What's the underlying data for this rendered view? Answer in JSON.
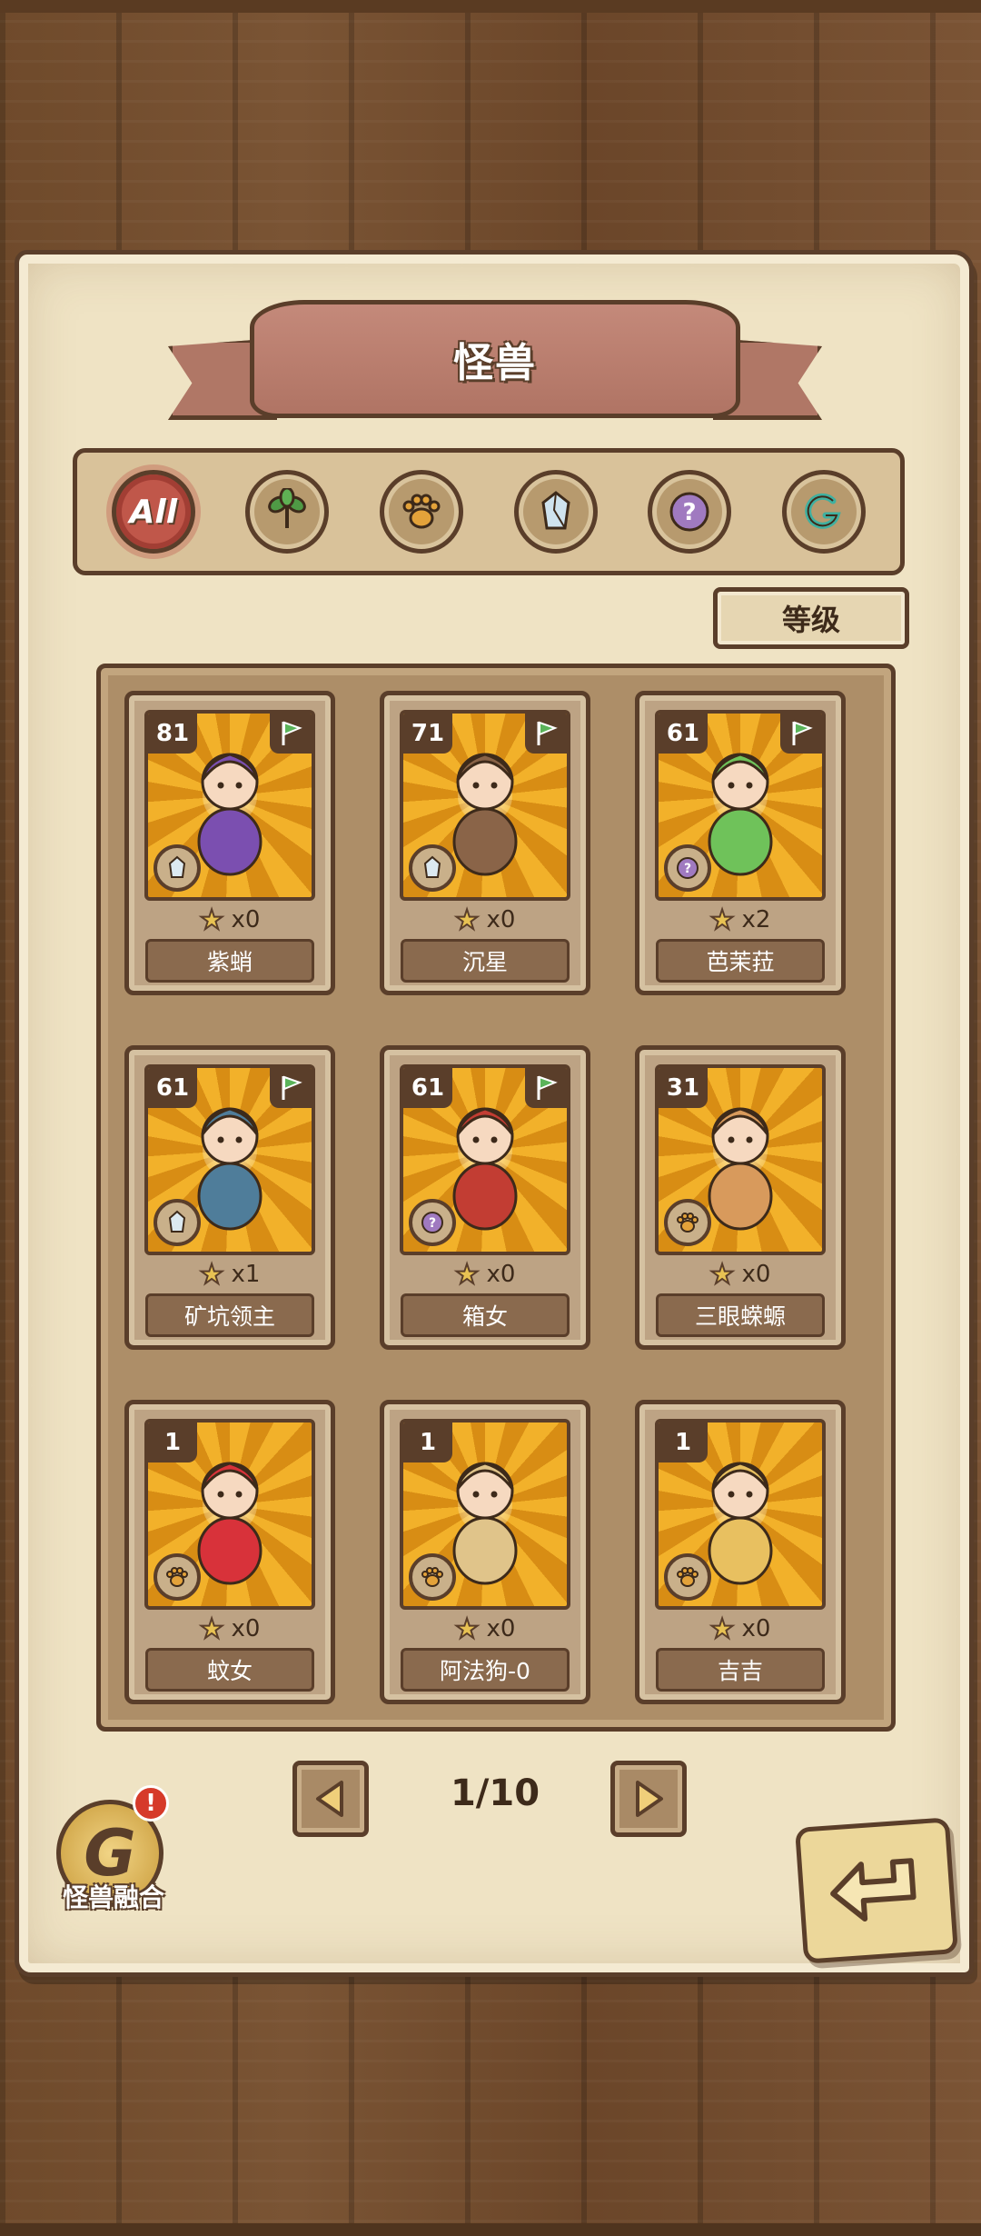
{
  "title": "怪兽",
  "filters": [
    {
      "label": "All",
      "icon": "all-icon",
      "active": true
    },
    {
      "label": "",
      "icon": "leaf-icon",
      "active": false
    },
    {
      "label": "",
      "icon": "paw-icon",
      "active": false
    },
    {
      "label": "",
      "icon": "crystal-icon",
      "active": false
    },
    {
      "label": "",
      "icon": "question-icon",
      "active": false
    },
    {
      "label": "",
      "icon": "fusion-icon",
      "active": false
    }
  ],
  "sort_label": "等级",
  "monsters": [
    {
      "level": "81",
      "stars": "x0",
      "name": "紫蛸",
      "type_icon": "crystal-icon",
      "flag": true
    },
    {
      "level": "71",
      "stars": "x0",
      "name": "沉星",
      "type_icon": "crystal-icon",
      "flag": true
    },
    {
      "level": "61",
      "stars": "x2",
      "name": "芭茉菈",
      "type_icon": "question-icon",
      "flag": true
    },
    {
      "level": "61",
      "stars": "x1",
      "name": "矿坑领主",
      "type_icon": "crystal-icon",
      "flag": true
    },
    {
      "level": "61",
      "stars": "x0",
      "name": "箱女",
      "type_icon": "question-icon",
      "flag": true
    },
    {
      "level": "31",
      "stars": "x0",
      "name": "三眼蝾螈",
      "type_icon": "paw-icon",
      "flag": false
    },
    {
      "level": "1",
      "stars": "x0",
      "name": "蚊女",
      "type_icon": "paw-icon",
      "flag": false
    },
    {
      "level": "1",
      "stars": "x0",
      "name": "阿法狗-0",
      "type_icon": "paw-icon",
      "flag": false
    },
    {
      "level": "1",
      "stars": "x0",
      "name": "吉吉",
      "type_icon": "paw-icon",
      "flag": false
    }
  ],
  "pagination": {
    "label": "1/10"
  },
  "fusion": {
    "label": "怪兽融合",
    "alert": "!"
  },
  "colors": {
    "accent_red": "#c0574a",
    "ink": "#5a3e2a",
    "parchment": "#efe3c4",
    "card_gold": "#f2b12a",
    "flag_green": "#5bb45a"
  }
}
